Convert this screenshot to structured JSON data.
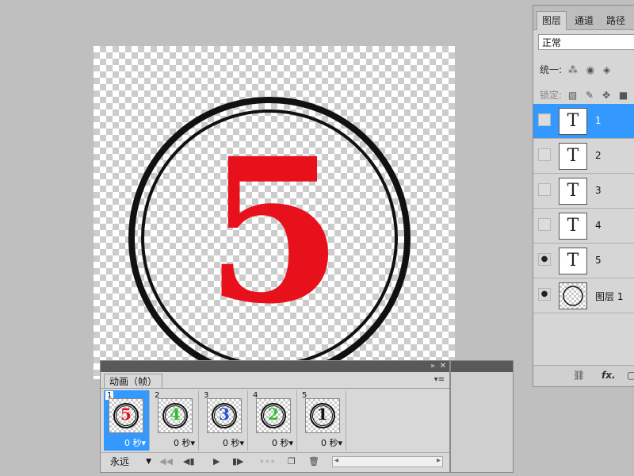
{
  "canvas": {
    "digit": "5",
    "digit_color": "#e8101a"
  },
  "layers_panel": {
    "tabs": [
      {
        "label": "图层",
        "active": true
      },
      {
        "label": "通道",
        "active": false
      },
      {
        "label": "路径",
        "active": false
      }
    ],
    "blend_mode": "正常",
    "unify_label": "统一:",
    "lock_label": "锁定:",
    "layers": [
      {
        "name": "1",
        "visible": false,
        "selected": true,
        "thumb": "T"
      },
      {
        "name": "2",
        "visible": false,
        "selected": false,
        "thumb": "T"
      },
      {
        "name": "3",
        "visible": false,
        "selected": false,
        "thumb": "T"
      },
      {
        "name": "4",
        "visible": false,
        "selected": false,
        "thumb": "T"
      },
      {
        "name": "5",
        "visible": true,
        "selected": false,
        "thumb": "T"
      },
      {
        "name": "图层 1",
        "visible": true,
        "selected": false,
        "thumb": ""
      }
    ],
    "bottom_icons": [
      "link-icon",
      "fx-icon"
    ],
    "fx_label": "fx."
  },
  "animation_panel": {
    "tab_label": "动画（帧）",
    "frames": [
      {
        "num": "1",
        "digit": "5",
        "color": "#e8101a",
        "delay": "0 秒",
        "selected": true
      },
      {
        "num": "2",
        "digit": "4",
        "color": "#2fc02f",
        "delay": "0 秒",
        "selected": false
      },
      {
        "num": "3",
        "digit": "3",
        "color": "#2a4fd8",
        "delay": "0 秒",
        "selected": false
      },
      {
        "num": "4",
        "digit": "2",
        "color": "#2fc02f",
        "delay": "0 秒",
        "selected": false
      },
      {
        "num": "5",
        "digit": "1",
        "color": "#111111",
        "delay": "0 秒",
        "selected": false
      }
    ],
    "loop_option": "永远"
  },
  "colors": {
    "selection_blue": "#3399ff",
    "canvas_bg": "#bfbfbf"
  }
}
